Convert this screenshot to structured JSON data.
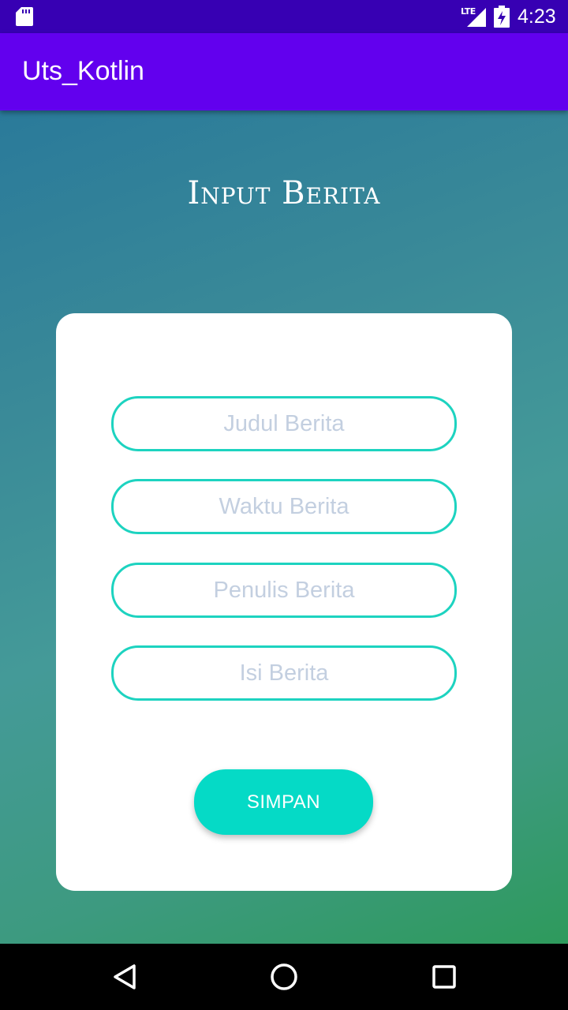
{
  "status_bar": {
    "network_label": "LTE",
    "clock": "4:23",
    "icons": [
      "sd-card-icon",
      "signal-icon",
      "battery-charging-icon"
    ]
  },
  "app_bar": {
    "title": "Uts_Kotlin",
    "color": "#6200ee",
    "status_color": "#3700b3"
  },
  "main": {
    "heading": "Input Berita",
    "form": {
      "fields": [
        {
          "placeholder": "Judul Berita",
          "value": ""
        },
        {
          "placeholder": "Waktu Berita",
          "value": ""
        },
        {
          "placeholder": "Penulis Berita",
          "value": ""
        },
        {
          "placeholder": "Isi Berita",
          "value": ""
        }
      ],
      "submit_label": "SIMPAN"
    },
    "accent_color": "#05dac6"
  },
  "nav_bar": {
    "buttons": [
      "back-icon",
      "home-icon",
      "recents-icon"
    ]
  }
}
